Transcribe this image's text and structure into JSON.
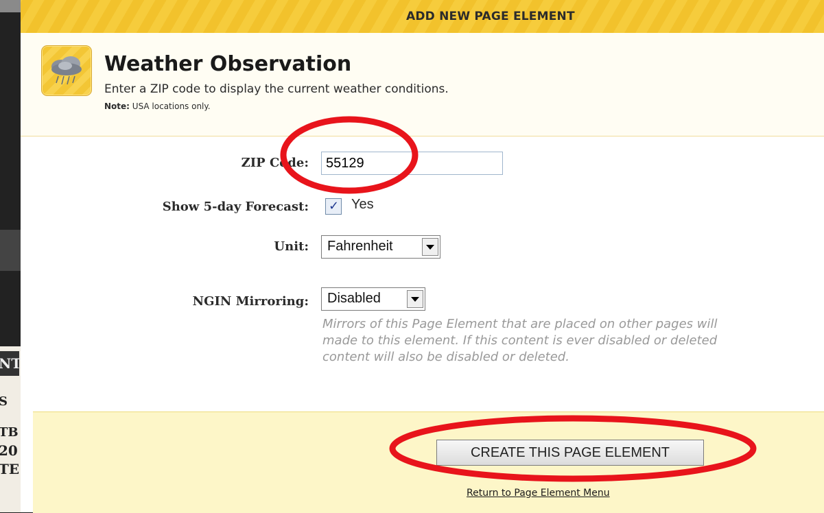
{
  "background_fragments": [
    "NT",
    "S",
    "TB",
    "20",
    "TE"
  ],
  "modal": {
    "title": "ADD NEW PAGE ELEMENT"
  },
  "header": {
    "icon": "weather-cloud-icon",
    "title": "Weather Observation",
    "subtitle": "Enter a ZIP code to display the current weather conditions.",
    "note_label": "Note:",
    "note_text": " USA locations only."
  },
  "form": {
    "zip": {
      "label": "ZIP Code:",
      "value": "55129"
    },
    "forecast": {
      "label": "Show 5-day Forecast:",
      "checked": true,
      "option_label": "Yes"
    },
    "unit": {
      "label": "Unit:",
      "selected": "Fahrenheit"
    },
    "mirroring": {
      "label": "NGIN Mirroring:",
      "selected": "Disabled",
      "help_lines": [
        "Mirrors of this Page Element that are placed on other pages will",
        "made to this element. If this content is ever disabled or deleted",
        "content will also be disabled or deleted."
      ]
    }
  },
  "footer": {
    "create_button": "CREATE THIS PAGE ELEMENT",
    "return_link": "Return to Page Element Menu"
  },
  "colors": {
    "title_stripe": "#f6cc3c",
    "footer_bg": "#fdf6c8",
    "annotation": "#e8141b"
  }
}
